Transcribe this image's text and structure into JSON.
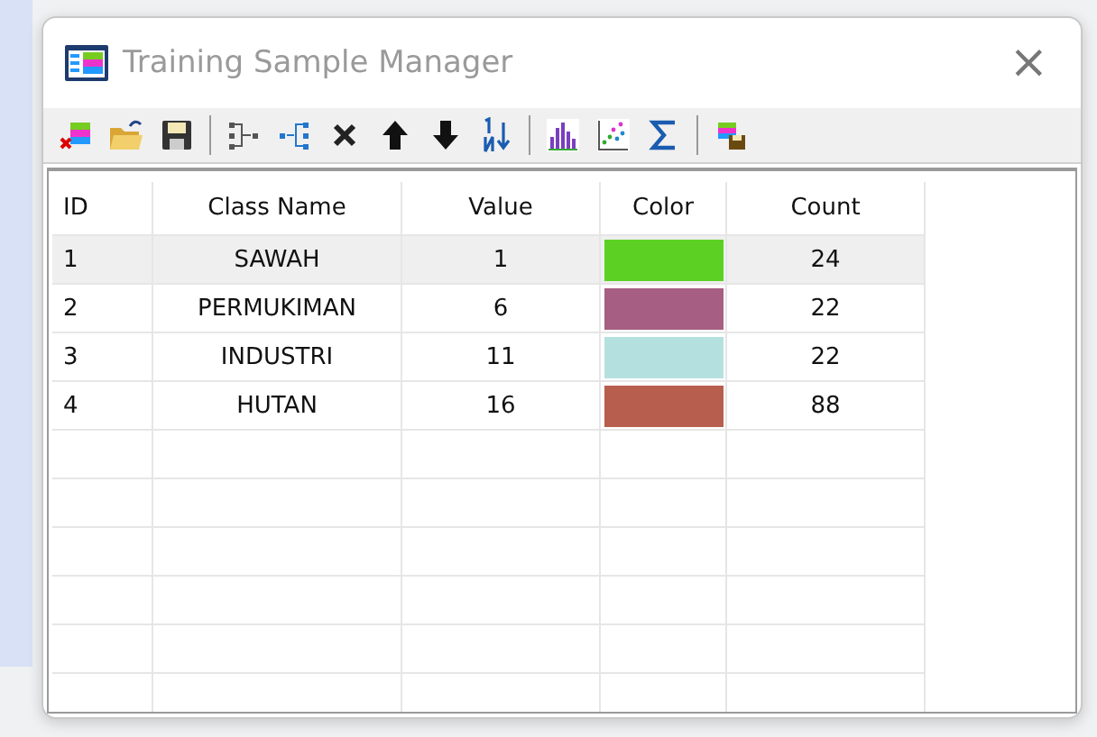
{
  "window": {
    "title": "Training Sample Manager",
    "close": "×"
  },
  "toolbar": [
    {
      "kind": "delete-class"
    },
    {
      "kind": "open"
    },
    {
      "kind": "save"
    },
    {
      "kind": "sep"
    },
    {
      "kind": "merge"
    },
    {
      "kind": "split"
    },
    {
      "kind": "remove"
    },
    {
      "kind": "up"
    },
    {
      "kind": "down"
    },
    {
      "kind": "sort"
    },
    {
      "kind": "sep"
    },
    {
      "kind": "histogram"
    },
    {
      "kind": "scatter"
    },
    {
      "kind": "sigma"
    },
    {
      "kind": "sep"
    },
    {
      "kind": "export"
    }
  ],
  "table": {
    "columns": [
      "ID",
      "Class Name",
      "Value",
      "Color",
      "Count"
    ],
    "rows": [
      {
        "id": "1",
        "class_name": "SAWAH",
        "value": "1",
        "color": "#5cd124",
        "count": "24",
        "selected": true
      },
      {
        "id": "2",
        "class_name": "PERMUKIMAN",
        "value": "6",
        "color": "#a65e83",
        "count": "22",
        "selected": false
      },
      {
        "id": "3",
        "class_name": "INDUSTRI",
        "value": "11",
        "color": "#b4e1e0",
        "count": "22",
        "selected": false
      },
      {
        "id": "4",
        "class_name": "HUTAN",
        "value": "16",
        "color": "#b85e4e",
        "count": "88",
        "selected": false
      }
    ]
  }
}
